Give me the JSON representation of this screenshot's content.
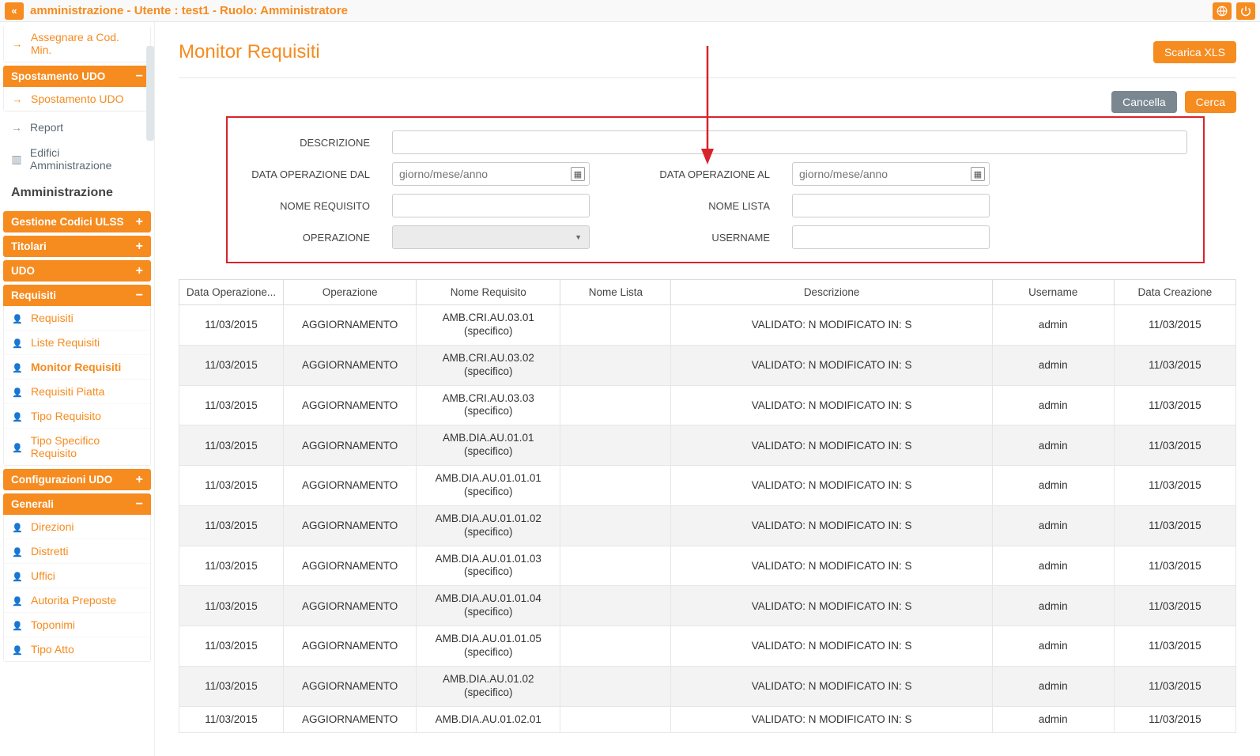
{
  "header": {
    "title": "amministrazione - Utente : test1 - Ruolo: Amministratore"
  },
  "sidebar": {
    "top_item": "Assegnare a Cod. Min.",
    "panels": [
      {
        "title": "Spostamento UDO",
        "open": true,
        "items": [
          {
            "label": "Spostamento UDO",
            "icon": "→"
          }
        ]
      },
      {
        "type": "links",
        "items": [
          {
            "label": "Report",
            "icon": "→"
          },
          {
            "label": "Edifici Amministrazione",
            "icon": "▥"
          }
        ]
      },
      {
        "type": "section_title",
        "label": "Amministrazione"
      },
      {
        "title": "Gestione Codici ULSS",
        "open": false
      },
      {
        "title": "Titolari",
        "open": false
      },
      {
        "title": "UDO",
        "open": false
      },
      {
        "title": "Requisiti",
        "open": true,
        "items": [
          {
            "label": "Requisiti"
          },
          {
            "label": "Liste Requisiti"
          },
          {
            "label": "Monitor Requisiti",
            "active": true
          },
          {
            "label": "Requisiti Piatta"
          },
          {
            "label": "Tipo Requisito"
          },
          {
            "label": "Tipo Specifico Requisito"
          }
        ]
      },
      {
        "title": "Configurazioni UDO",
        "open": false
      },
      {
        "title": "Generali",
        "open": true,
        "items": [
          {
            "label": "Direzioni"
          },
          {
            "label": "Distretti"
          },
          {
            "label": "Uffici"
          },
          {
            "label": "Autorita Preposte"
          },
          {
            "label": "Toponimi"
          },
          {
            "label": "Tipo Atto"
          }
        ]
      }
    ]
  },
  "page": {
    "title": "Monitor Requisiti",
    "download_xls": "Scarica XLS",
    "cancel": "Cancella",
    "search": "Cerca"
  },
  "filters": {
    "descrizione_label": "DESCRIZIONE",
    "data_dal_label": "DATA OPERAZIONE DAL",
    "data_al_label": "DATA OPERAZIONE AL",
    "date_placeholder": "giorno/mese/anno",
    "nome_requisito_label": "NOME REQUISITO",
    "nome_lista_label": "NOME LISTA",
    "operazione_label": "OPERAZIONE",
    "username_label": "USERNAME"
  },
  "table": {
    "columns": [
      "Data Operazione...",
      "Operazione",
      "Nome Requisito",
      "Nome Lista",
      "Descrizione",
      "Username",
      "Data Creazione"
    ],
    "rows": [
      {
        "data_op": "11/03/2015",
        "op": "AGGIORNAMENTO",
        "req1": "AMB.CRI.AU.03.01",
        "req2": "(specifico)",
        "lista": "",
        "desc": "VALIDATO: N MODIFICATO IN: S",
        "user": "admin",
        "data_cr": "11/03/2015"
      },
      {
        "data_op": "11/03/2015",
        "op": "AGGIORNAMENTO",
        "req1": "AMB.CRI.AU.03.02",
        "req2": "(specifico)",
        "lista": "",
        "desc": "VALIDATO: N MODIFICATO IN: S",
        "user": "admin",
        "data_cr": "11/03/2015"
      },
      {
        "data_op": "11/03/2015",
        "op": "AGGIORNAMENTO",
        "req1": "AMB.CRI.AU.03.03",
        "req2": "(specifico)",
        "lista": "",
        "desc": "VALIDATO: N MODIFICATO IN: S",
        "user": "admin",
        "data_cr": "11/03/2015"
      },
      {
        "data_op": "11/03/2015",
        "op": "AGGIORNAMENTO",
        "req1": "AMB.DIA.AU.01.01",
        "req2": "(specifico)",
        "lista": "",
        "desc": "VALIDATO: N MODIFICATO IN: S",
        "user": "admin",
        "data_cr": "11/03/2015"
      },
      {
        "data_op": "11/03/2015",
        "op": "AGGIORNAMENTO",
        "req1": "AMB.DIA.AU.01.01.01",
        "req2": "(specifico)",
        "lista": "",
        "desc": "VALIDATO: N MODIFICATO IN: S",
        "user": "admin",
        "data_cr": "11/03/2015"
      },
      {
        "data_op": "11/03/2015",
        "op": "AGGIORNAMENTO",
        "req1": "AMB.DIA.AU.01.01.02",
        "req2": "(specifico)",
        "lista": "",
        "desc": "VALIDATO: N MODIFICATO IN: S",
        "user": "admin",
        "data_cr": "11/03/2015"
      },
      {
        "data_op": "11/03/2015",
        "op": "AGGIORNAMENTO",
        "req1": "AMB.DIA.AU.01.01.03",
        "req2": "(specifico)",
        "lista": "",
        "desc": "VALIDATO: N MODIFICATO IN: S",
        "user": "admin",
        "data_cr": "11/03/2015"
      },
      {
        "data_op": "11/03/2015",
        "op": "AGGIORNAMENTO",
        "req1": "AMB.DIA.AU.01.01.04",
        "req2": "(specifico)",
        "lista": "",
        "desc": "VALIDATO: N MODIFICATO IN: S",
        "user": "admin",
        "data_cr": "11/03/2015"
      },
      {
        "data_op": "11/03/2015",
        "op": "AGGIORNAMENTO",
        "req1": "AMB.DIA.AU.01.01.05",
        "req2": "(specifico)",
        "lista": "",
        "desc": "VALIDATO: N MODIFICATO IN: S",
        "user": "admin",
        "data_cr": "11/03/2015"
      },
      {
        "data_op": "11/03/2015",
        "op": "AGGIORNAMENTO",
        "req1": "AMB.DIA.AU.01.02",
        "req2": "(specifico)",
        "lista": "",
        "desc": "VALIDATO: N MODIFICATO IN: S",
        "user": "admin",
        "data_cr": "11/03/2015"
      },
      {
        "data_op": "11/03/2015",
        "op": "AGGIORNAMENTO",
        "req1": "AMB.DIA.AU.01.02.01",
        "req2": "",
        "lista": "",
        "desc": "VALIDATO: N MODIFICATO IN: S",
        "user": "admin",
        "data_cr": "11/03/2015"
      }
    ]
  }
}
